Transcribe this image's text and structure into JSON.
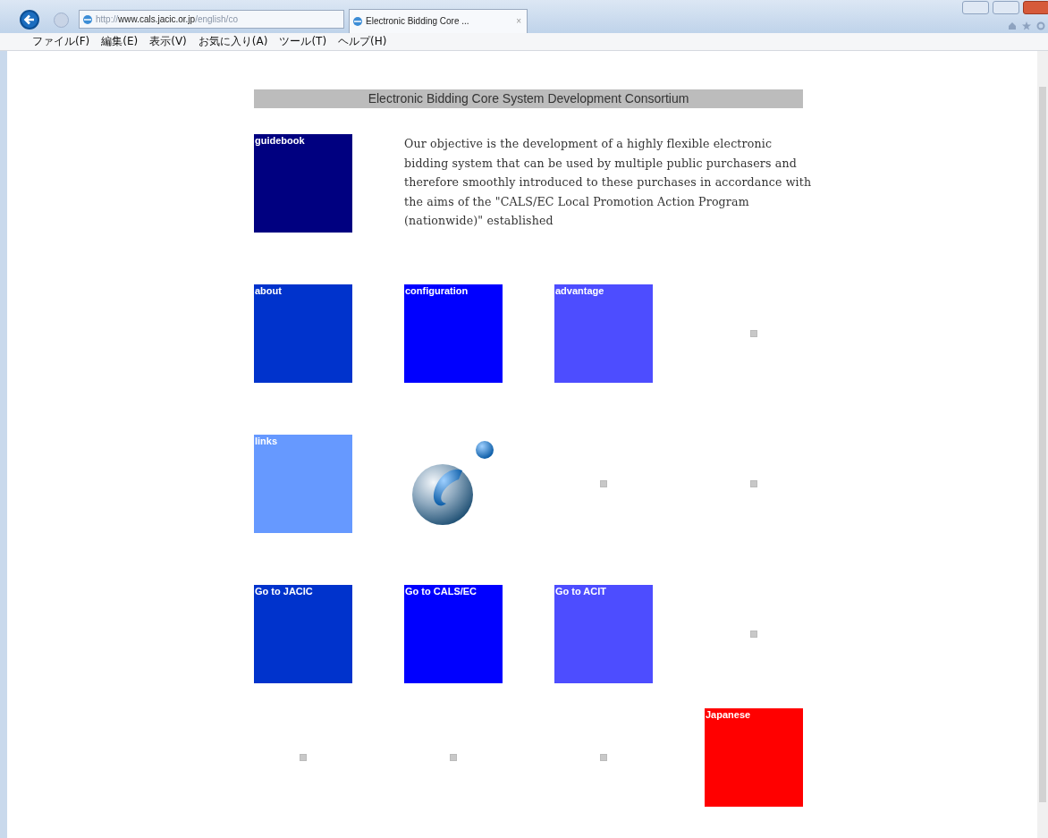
{
  "browser": {
    "address": {
      "scheme": "http://",
      "host": "www.cals.jacic.or.jp",
      "path": "/english/co"
    },
    "tab": {
      "title": "Electronic Bidding Core ...",
      "close": "×"
    },
    "menu": [
      "ファイル(F)",
      "編集(E)",
      "表示(V)",
      "お気に入り(A)",
      "ツール(T)",
      "ヘルプ(H)"
    ]
  },
  "page": {
    "header": "Electronic Bidding Core System Development Consortium",
    "rows": [
      [
        {
          "kind": "tile",
          "label": "guidebook",
          "color": "#000080"
        },
        {
          "kind": "text",
          "text": "Our objective is the development of a highly flexible electronic bidding system that can be used by multiple public purchasers and therefore smoothly introduced to these purchases in accordance with the aims of the \"CALS/EC Local Promotion Action Program (nationwide)\" established"
        }
      ],
      [
        {
          "kind": "tile",
          "label": "about",
          "color": "#0033cc"
        },
        {
          "kind": "tile",
          "label": "configuration",
          "color": "#0000ff"
        },
        {
          "kind": "tile",
          "label": "advantage",
          "color": "#4d4dff"
        },
        {
          "kind": "placeholder"
        }
      ],
      [
        {
          "kind": "tile",
          "label": "links",
          "color": "#6699ff"
        },
        {
          "kind": "logo"
        },
        {
          "kind": "placeholder"
        },
        {
          "kind": "placeholder"
        }
      ],
      [
        {
          "kind": "tile",
          "label": "Go to JACIC",
          "color": "#0033cc"
        },
        {
          "kind": "tile",
          "label": "Go to CALS/EC",
          "color": "#0000ff"
        },
        {
          "kind": "tile",
          "label": "Go to ACIT",
          "color": "#4d4dff"
        },
        {
          "kind": "placeholder"
        }
      ],
      [
        {
          "kind": "placeholder"
        },
        {
          "kind": "placeholder"
        },
        {
          "kind": "placeholder"
        },
        {
          "kind": "tile",
          "label": "Japanese",
          "color": "#ff0000"
        }
      ]
    ]
  }
}
